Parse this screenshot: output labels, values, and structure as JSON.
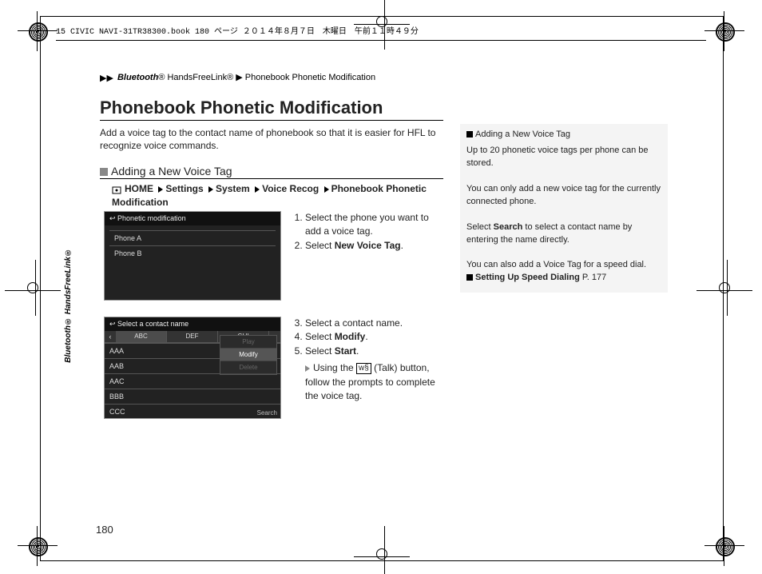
{
  "bookline": "15 CIVIC NAVI-31TR38300.book  180 ページ  ２０１４年８月７日　木曜日　午前１１時４９分",
  "breadcrumb": {
    "a": "Bluetooth",
    "b": "® HandsFreeLink®",
    "c": "Phonebook Phonetic Modification"
  },
  "title": "Phonebook Phonetic Modification",
  "intro": "Add a voice tag to the contact name of phonebook so that it is easier for HFL to recognize voice commands.",
  "subhead": "Adding a New Voice Tag",
  "nav": {
    "home": "HOME",
    "s1": "Settings",
    "s2": "System",
    "s3": "Voice Recog",
    "s4": "Phonebook Phonetic Modification"
  },
  "shot1": {
    "hdr": "Phonetic modification",
    "r1": "Phone A",
    "r2": "Phone B"
  },
  "shot2": {
    "hdr": "Select a contact name",
    "tabs": {
      "back": "‹",
      "t1": "ABC",
      "t2": "DEF",
      "t3": "GHI",
      "more": "›"
    },
    "rows": {
      "r1": "AAA",
      "r2": "AAB",
      "r3": "AAC",
      "r4": "BBB",
      "r5": "CCC"
    },
    "popup": {
      "p1": "Play",
      "p2": "Modify",
      "p3": "Delete"
    },
    "search": "Search"
  },
  "steps1": {
    "s1": "Select the phone you want to add a voice tag.",
    "s2a": "Select ",
    "s2b": "New Voice Tag",
    "s2c": "."
  },
  "steps2": {
    "s3": "Select a contact name.",
    "s4a": "Select ",
    "s4b": "Modify",
    "s4c": ".",
    "s5a": "Select ",
    "s5b": "Start",
    "s5c": ".",
    "sub_a": "Using the ",
    "sub_icon": "w§",
    "sub_b": " (Talk) button, follow the prompts to complete the voice tag."
  },
  "side": {
    "head": "Adding a New Voice Tag",
    "p1": "Up to 20 phonetic voice tags per phone can be stored.",
    "p2": "You can only add a new voice tag for the currently connected phone.",
    "p3a": "Select ",
    "p3b": "Search",
    "p3c": " to select a contact name by entering the name directly.",
    "p4": "You can also add a Voice Tag for a speed dial.",
    "link": "Setting Up Speed Dialing",
    "pg": " P. 177"
  },
  "pagenum": "180",
  "sidelabel": "Bluetooth® HandsFreeLink®"
}
